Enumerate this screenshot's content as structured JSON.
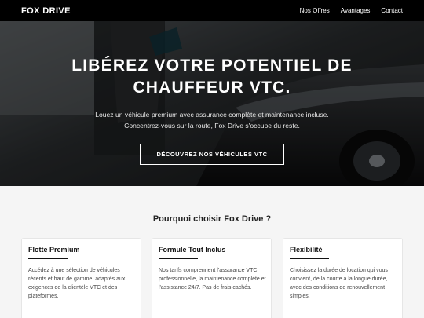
{
  "navbar": {
    "brand": "FOX DRIVE",
    "links": [
      "Nos Offres",
      "Avantages",
      "Contact"
    ]
  },
  "hero": {
    "title": "LIBÉREZ VOTRE POTENTIEL DE CHAUFFEUR VTC.",
    "subtitle_line1": "Louez un véhicule premium avec assurance complète et maintenance incluse.",
    "subtitle_line2": "Concentrez-vous sur la route, Fox Drive s'occupe du reste.",
    "cta_label": "DÉCOUVREZ NOS VÉHICULES VTC"
  },
  "features": {
    "heading": "Pourquoi choisir Fox Drive ?",
    "cards": [
      {
        "title": "Flotte Premium",
        "text": "Accédez à une sélection de véhicules récents et haut de gamme, adaptés aux exigences de la clientèle VTC et des plateformes."
      },
      {
        "title": "Formule Tout Inclus",
        "text": "Nos tarifs comprennent l'assurance VTC professionnelle, la maintenance complète et l'assistance 24/7. Pas de frais cachés."
      },
      {
        "title": "Flexibilité",
        "text": "Choisissez la durée de location qui vous convient, de la courte à la longue durée, avec des conditions de renouvellement simples."
      }
    ]
  },
  "colors": {
    "navbar_bg": "#000000",
    "page_bg": "#f5f5f5",
    "card_bg": "#ffffff",
    "accent": "#111111"
  }
}
